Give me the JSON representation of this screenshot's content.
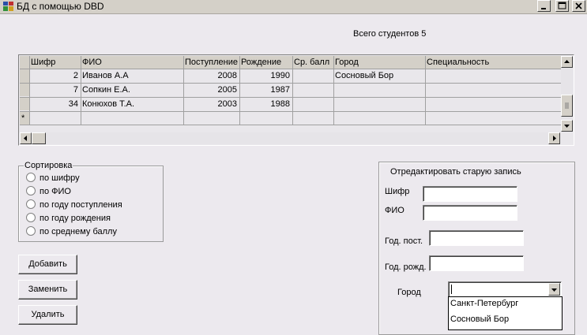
{
  "window": {
    "title": "БД с помощью DBD",
    "icon": "database-app-icon",
    "controls": [
      "minimize-icon",
      "maximize-icon",
      "close-icon"
    ]
  },
  "summary": {
    "total_students": "Всего студентов 5"
  },
  "grid": {
    "columns": [
      "Шифр",
      "ФИО",
      "Поступление",
      "Рождение",
      "Ср. балл",
      "Город",
      "Специальность"
    ],
    "rows": [
      {
        "code": "2",
        "name": "Иванов А.А",
        "admission": "2008",
        "birth": "1990",
        "avg": "",
        "city": "Сосновый Бор",
        "specialty": ""
      },
      {
        "code": "7",
        "name": "Сопкин Е.А.",
        "admission": "2005",
        "birth": "1987",
        "avg": "",
        "city": "",
        "specialty": ""
      },
      {
        "code": "34",
        "name": "Конюхов Т.А.",
        "admission": "2003",
        "birth": "1988",
        "avg": "",
        "city": "",
        "specialty": ""
      }
    ],
    "new_row_marker": "*"
  },
  "sort": {
    "title": "Сортировка",
    "options": [
      "по шифру",
      "по ФИО",
      "по году поступления",
      "по году рождения",
      "по среднему баллу"
    ]
  },
  "buttons": {
    "add": "Добавить",
    "replace": "Заменить",
    "delete": "Удалить"
  },
  "edit": {
    "title": "Отредактировать старую запись",
    "code_label": "Шифр",
    "name_label": "ФИО",
    "admission_label": "Год. пост.",
    "birth_label": "Год. рожд.",
    "city_label": "Город",
    "code_value": "",
    "name_value": "",
    "admission_value": "",
    "birth_value": ""
  },
  "city_dropdown": {
    "selected": "",
    "options": [
      "Санкт-Петербург",
      "Сосновый Бор"
    ]
  },
  "colors": {
    "window_bg": "#ece9ee",
    "chrome": "#d4d0c8",
    "grid_bg": "#e9e7eb"
  }
}
